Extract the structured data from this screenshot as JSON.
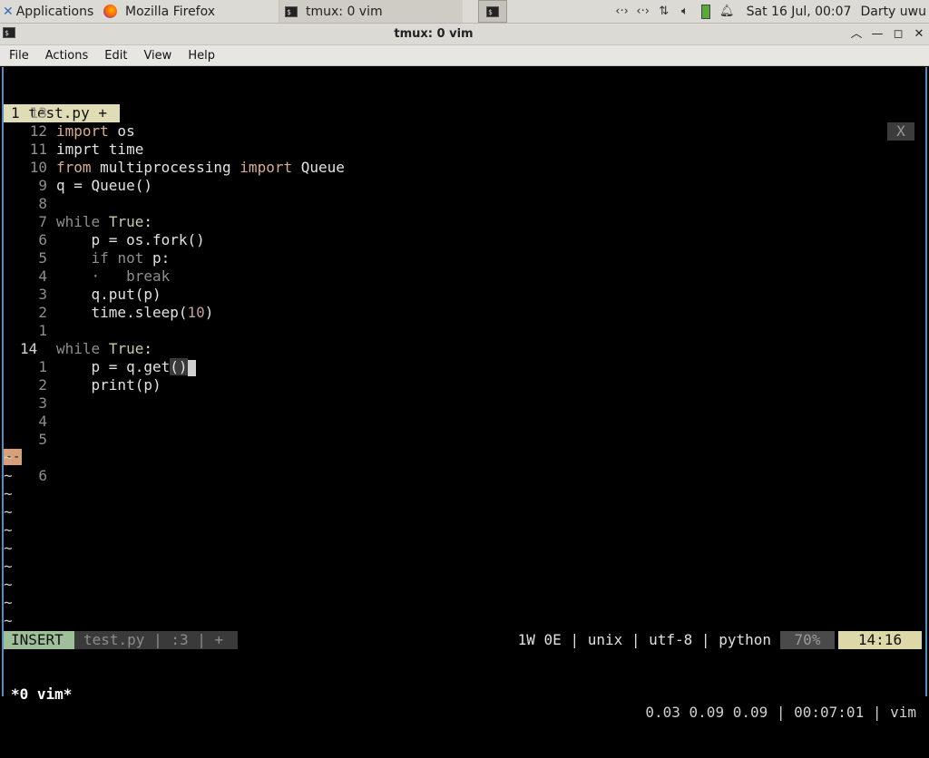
{
  "panel": {
    "applications": "Applications",
    "tasks": [
      {
        "label": "Mozilla Firefox",
        "icon": "firefox-icon"
      },
      {
        "label": "tmux: 0 vim",
        "icon": "terminal-icon"
      }
    ],
    "clock": "Sat 16 Jul, 00:07",
    "user": "Darty uwu"
  },
  "window": {
    "title": "tmux: 0 vim"
  },
  "menu": [
    "File",
    "Actions",
    "Edit",
    "View",
    "Help"
  ],
  "vim": {
    "tab_label": "1 test.py +",
    "tab_close": "X",
    "lines": [
      {
        "n": "13",
        "text": "import os"
      },
      {
        "n": "12",
        "text": "imprt time"
      },
      {
        "n": "11",
        "text": "from multiprocessing import Queue"
      },
      {
        "n": "10",
        "text": "q = Queue()"
      },
      {
        "n": "9",
        "text": ""
      },
      {
        "n": "8",
        "text": "while True:"
      },
      {
        "n": "7",
        "text": "    p = os.fork()"
      },
      {
        "n": "6",
        "text": "    if not p:"
      },
      {
        "n": "5",
        "text": "    ·   break"
      },
      {
        "n": "4",
        "text": "    q.put(p)"
      },
      {
        "n": "3",
        "text": "    time.sleep(10)"
      },
      {
        "n": "2",
        "text": ""
      },
      {
        "n": "1",
        "text": "while True:"
      },
      {
        "n": "14",
        "text": "    p = q.get()"
      },
      {
        "n": "1",
        "text": "    print(p)"
      },
      {
        "n": "2",
        "text": ""
      },
      {
        "n": "3",
        "text": ""
      },
      {
        "n": "4",
        "text": ""
      },
      {
        "n": "5",
        "text": ""
      },
      {
        "n": "6",
        "text": ""
      }
    ],
    "sign_mark": "--",
    "tilde": "~",
    "status": {
      "mode": "INSERT",
      "file": "test.py | :3 | +",
      "info": "1W 0E | unix | utf-8 | python",
      "percent": "70%",
      "position": "14:16"
    }
  },
  "tmux": {
    "window": "*0 vim*",
    "right": "0.03 0.09 0.09 | 00:07:01 | vim"
  }
}
